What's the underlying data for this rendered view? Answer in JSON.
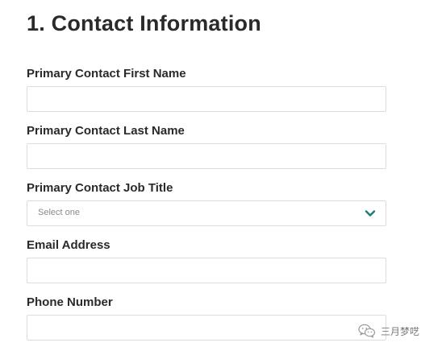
{
  "section": {
    "title": "1. Contact Information"
  },
  "fields": [
    {
      "label": "Primary Contact First Name",
      "value": "",
      "type": "text"
    },
    {
      "label": "Primary Contact Last Name",
      "value": "",
      "type": "text"
    },
    {
      "label": "Primary Contact Job Title",
      "type": "select",
      "selected": "Select one"
    },
    {
      "label": "Email Address",
      "value": "",
      "type": "text"
    },
    {
      "label": "Phone Number",
      "value": "",
      "type": "text"
    }
  ],
  "colors": {
    "accent": "#1b7d74",
    "label": "#2a2a2a",
    "border": "#dcdcdc",
    "placeholder": "#8a8a8a"
  },
  "icons": {
    "dropdown": "chevron-down-icon",
    "watermark": "wechat-logo-icon"
  },
  "watermark": {
    "label": "三月梦呓"
  }
}
